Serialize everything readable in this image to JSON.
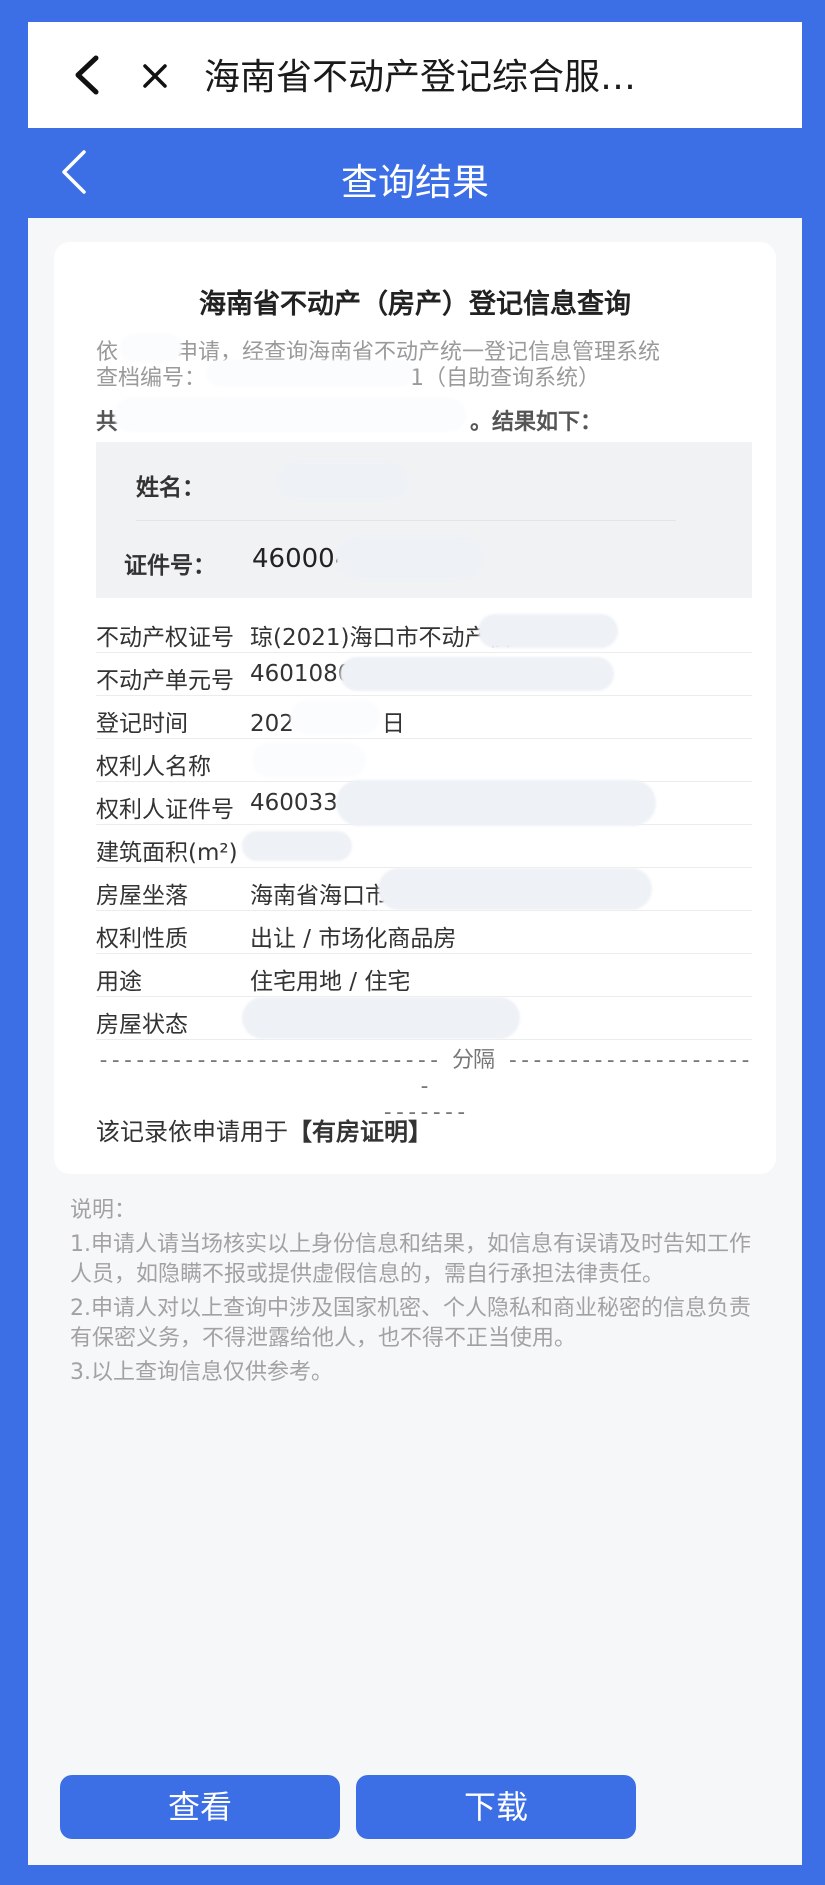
{
  "window": {
    "title": "海南省不动产登记综合服…"
  },
  "header": {
    "title": "查询结果"
  },
  "card": {
    "title": "海南省不动产（房产）登记信息查询",
    "intro_line1_a": "依",
    "intro_line1_b": "申请，经查询海南省不动产统一登记信息管理系统",
    "intro_line2_a": "查档编号：",
    "intro_line2_b": "1（自助查询系统）",
    "intro_line3_a": "共",
    "intro_line3_b": "。结果如下：",
    "name_label": "姓名：",
    "id_label": "证件号：",
    "id_value": "460004",
    "rows": [
      {
        "key": "不动产权证号",
        "value": "琼(2021)海口市不动产权"
      },
      {
        "key": "不动产单元号",
        "value": "4601080"
      },
      {
        "key": "登记时间",
        "value": "202",
        "value_b": "日"
      },
      {
        "key": "权利人名称",
        "value": ""
      },
      {
        "key": "权利人证件号",
        "value": "4600331"
      },
      {
        "key": "建筑面积(m²)",
        "value": ""
      },
      {
        "key": "房屋坐落",
        "value": "海南省海口市"
      },
      {
        "key": "权利性质",
        "value": "出让 / 市场化商品房"
      },
      {
        "key": "用途",
        "value": "住宅用地 / 住宅"
      },
      {
        "key": "房屋状态",
        "value": ""
      }
    ],
    "divider_line1": "---------------------------- 分隔 ---------------------",
    "divider_line2": "-------",
    "usage_prefix": "该记录依申请用于",
    "usage_value": "【有房证明】"
  },
  "notes": {
    "heading": "说明：",
    "items": [
      "1.申请人请当场核实以上身份信息和结果，如信息有误请及时告知工作人员，如隐瞒不报或提供虚假信息的，需自行承担法律责任。",
      "2.申请人对以上查询中涉及国家机密、个人隐私和商业秘密的信息负责有保密义务，不得泄露给他人，也不得不正当使用。",
      "3.以上查询信息仅供参考。"
    ]
  },
  "buttons": {
    "view": "查看",
    "download": "下载"
  }
}
